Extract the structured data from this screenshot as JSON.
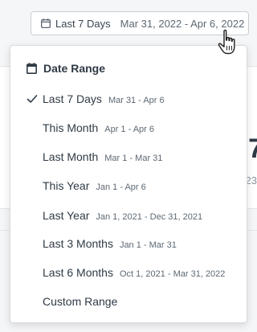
{
  "trigger": {
    "label": "Last 7 Days",
    "range": "Mar 31, 2022 - Apr 6, 2022"
  },
  "menu": {
    "header": "Date Range",
    "items": [
      {
        "label": "Last 7 Days",
        "sub": "Mar 31 - Apr 6",
        "selected": true
      },
      {
        "label": "This Month",
        "sub": "Apr 1 - Apr 6",
        "selected": false
      },
      {
        "label": "Last Month",
        "sub": "Mar 1 - Mar 31",
        "selected": false
      },
      {
        "label": "This Year",
        "sub": "Jan 1 - Apr 6",
        "selected": false
      },
      {
        "label": "Last Year",
        "sub": "Jan 1, 2021 - Dec 31, 2021",
        "selected": false
      },
      {
        "label": "Last 3 Months",
        "sub": "Jan 1 - Mar 31",
        "selected": false
      },
      {
        "label": "Last 6 Months",
        "sub": "Oct 1, 2021 - Mar 31, 2022",
        "selected": false
      },
      {
        "label": "Custom Range",
        "sub": "",
        "selected": false
      }
    ]
  },
  "background": {
    "metric_partial": "7",
    "sub_partial": "23"
  },
  "icons": {
    "calendar": "calendar-icon",
    "check": "checkmark-icon",
    "cursor": "hand-pointer-icon"
  },
  "colors": {
    "text": "#2f3a45",
    "muted": "#5d6873",
    "border": "#c9ced3"
  }
}
